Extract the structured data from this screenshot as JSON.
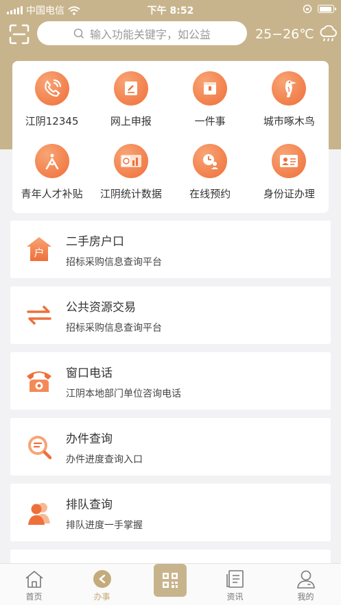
{
  "status_bar": {
    "carrier": "中国电信",
    "time": "下午 8:52",
    "battery_level": 0.9
  },
  "header": {
    "search_placeholder": "输入功能关键字，如公益",
    "weather_temp": "25−26℃",
    "weather_icon": "cloud-rain-icon"
  },
  "quick_actions": [
    {
      "label": "江阴12345",
      "icon": "phone-icon"
    },
    {
      "label": "网上申报",
      "icon": "edit-doc-icon"
    },
    {
      "label": "一件事",
      "icon": "folder-icon"
    },
    {
      "label": "城市啄木鸟",
      "icon": "woodpecker-icon"
    },
    {
      "label": "青年人才补贴",
      "icon": "youth-icon"
    },
    {
      "label": "江阴统计数据",
      "icon": "statistics-icon"
    },
    {
      "label": "在线预约",
      "icon": "appointment-icon"
    },
    {
      "label": "身份证办理",
      "icon": "id-card-icon"
    }
  ],
  "list": [
    {
      "title": "二手房户口",
      "subtitle": "招标采购信息查询平台",
      "icon": "house-icon"
    },
    {
      "title": "公共资源交易",
      "subtitle": "招标采购信息查询平台",
      "icon": "exchange-icon"
    },
    {
      "title": "窗口电话",
      "subtitle": "江阴本地部门单位咨询电话",
      "icon": "telephone-icon"
    },
    {
      "title": "办件查询",
      "subtitle": "办件进度查询入口",
      "icon": "search-doc-icon"
    },
    {
      "title": "排队查询",
      "subtitle": "排队进度一手掌握",
      "icon": "queue-icon"
    }
  ],
  "tabbar": {
    "items": [
      {
        "label": "首页",
        "icon": "home-icon"
      },
      {
        "label": "办事",
        "icon": "service-icon",
        "active": true
      },
      {
        "label": "",
        "icon": "qr-code-icon"
      },
      {
        "label": "资讯",
        "icon": "news-icon"
      },
      {
        "label": "我的",
        "icon": "profile-icon"
      }
    ]
  },
  "colors": {
    "brand": "#c8b48c",
    "accent": "#ef6f3a",
    "accent_light": "#f8a474",
    "active_tab": "#c4ab7b"
  }
}
